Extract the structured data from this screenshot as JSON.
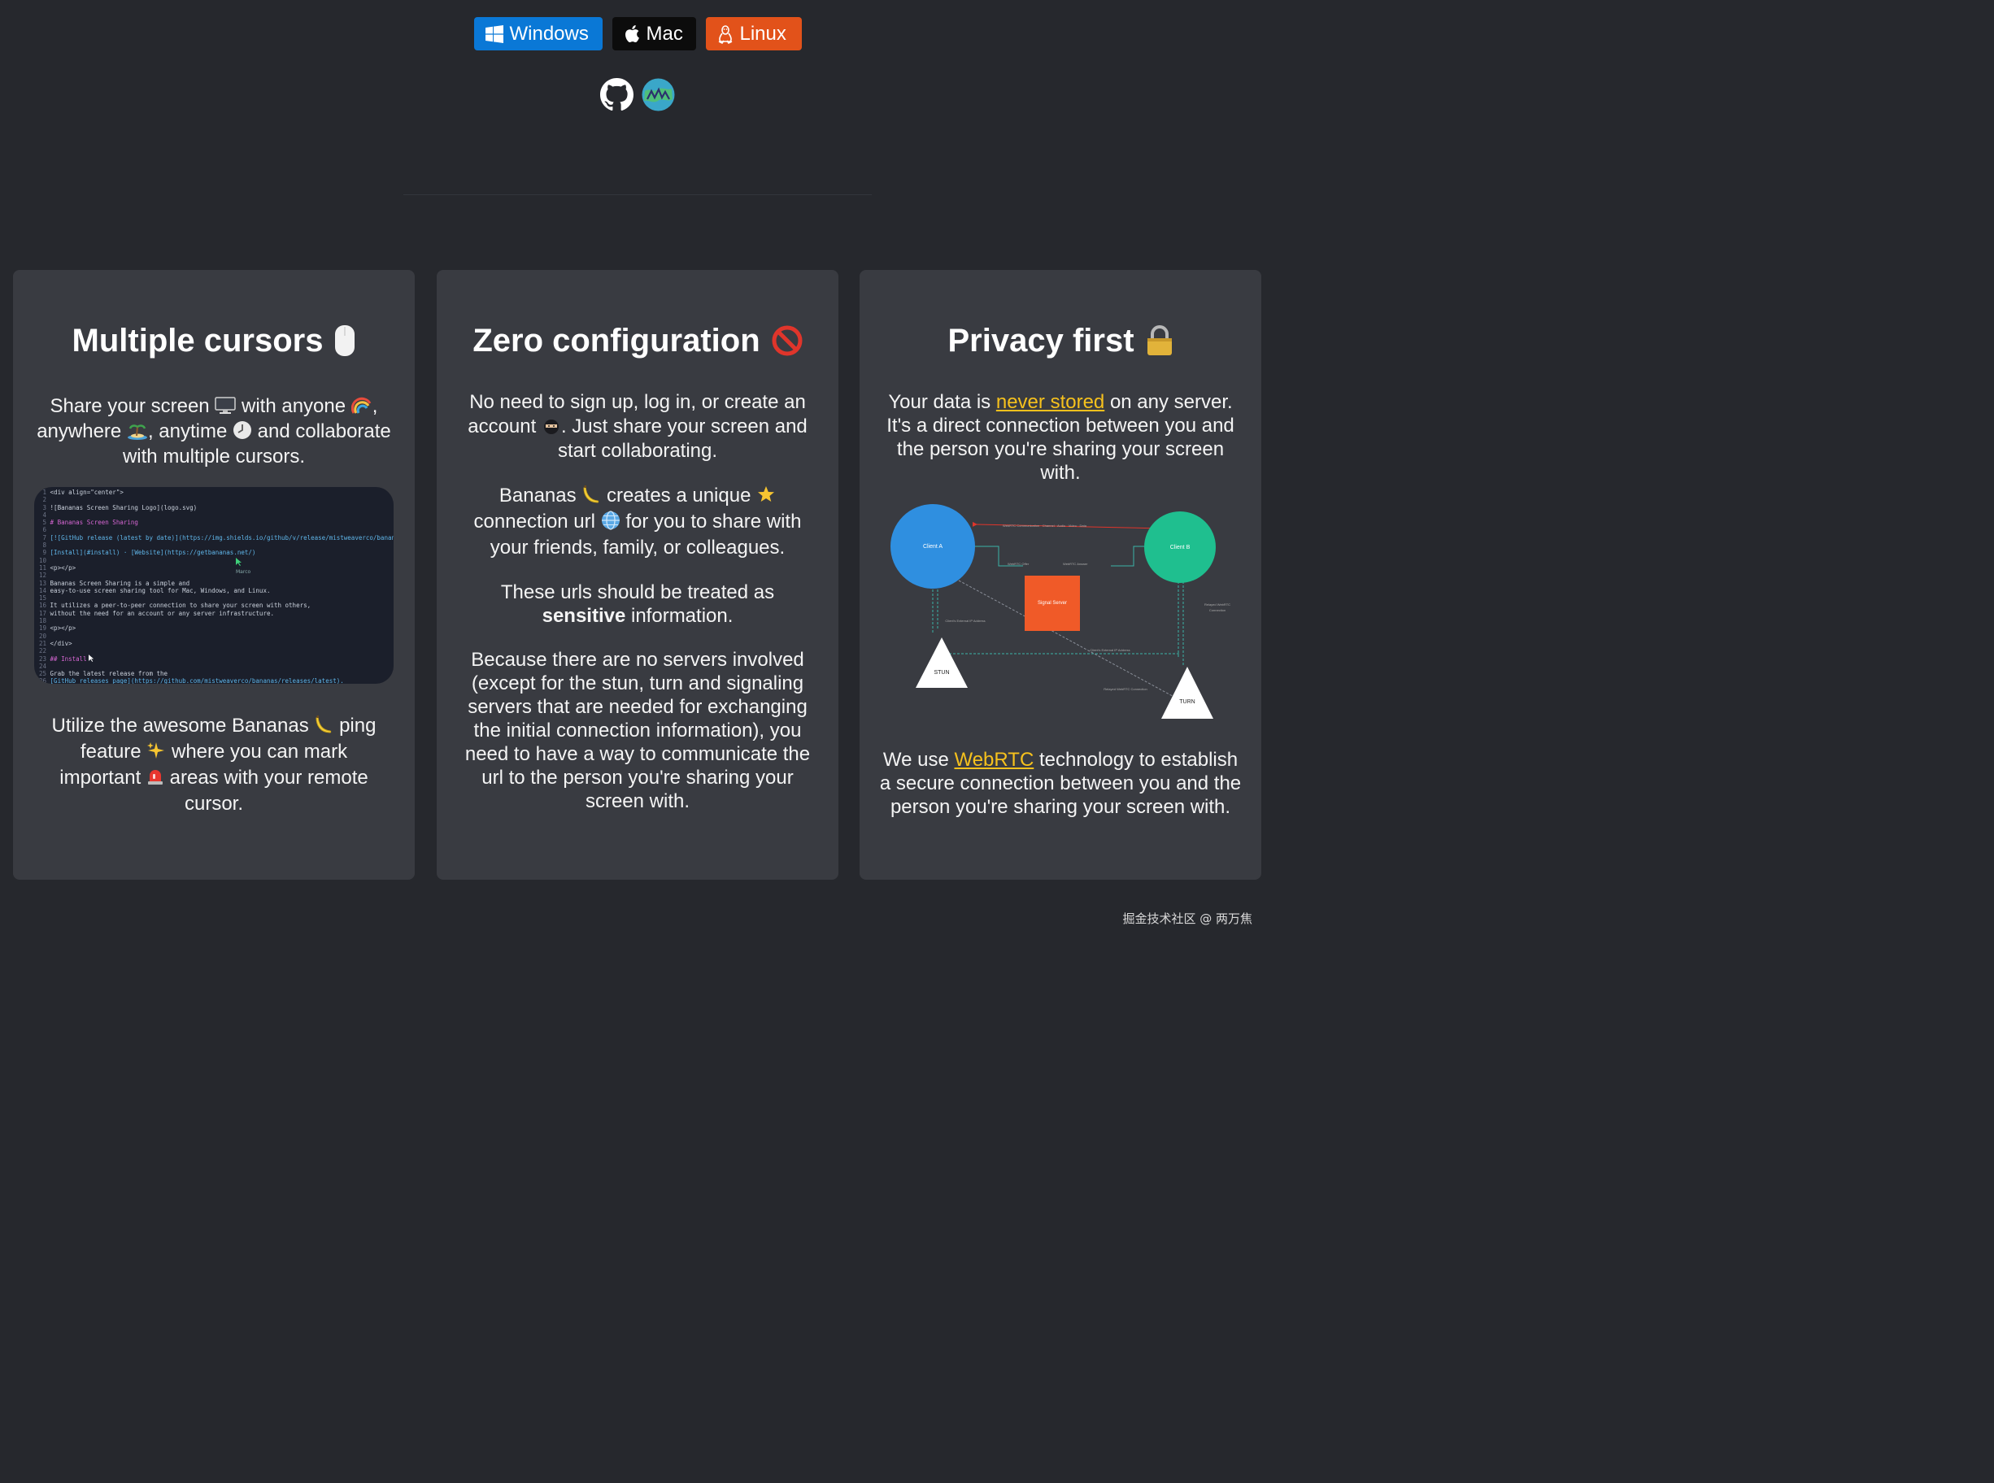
{
  "downloads": {
    "windows_label": "Windows",
    "mac_label": "Mac",
    "linux_label": "Linux"
  },
  "social": {
    "github": "github-icon",
    "website": "globe-logo-icon"
  },
  "colors": {
    "background": "#26282d",
    "card": "#393b41",
    "windows": "#0a78d6",
    "mac": "#0c0c0c",
    "linux": "#e2521a",
    "link": "#f6c11d"
  },
  "cards": [
    {
      "title": "Multiple cursors",
      "title_icon": "computer-mouse",
      "paragraphs": {
        "intro_1": "Share your screen",
        "intro_2": "with anyone",
        "intro_3": ",",
        "intro_4": "anywhere",
        "intro_5": ", anytime",
        "intro_6": "and collaborate",
        "intro_7": "with multiple cursors.",
        "ping_1": "Utilize the awesome Bananas",
        "ping_2": "ping",
        "ping_3": "feature",
        "ping_4": "where you can mark",
        "ping_5": "important",
        "ping_6": "areas with your remote",
        "ping_7": "cursor."
      },
      "code_lines": [
        {
          "n": "1",
          "t": "<div align=\"center\">"
        },
        {
          "n": "2",
          "t": ""
        },
        {
          "n": "3",
          "t": "![Bananas Screen Sharing Logo](logo.svg)"
        },
        {
          "n": "4",
          "t": ""
        },
        {
          "n": "5",
          "t": "# Bananas Screen Sharing"
        },
        {
          "n": "6",
          "t": ""
        },
        {
          "n": "7",
          "t": "[![GitHub release (latest by date)](https://img.shields.io/github/v/release/mistweaverco/bananas"
        },
        {
          "n": "8",
          "t": ""
        },
        {
          "n": "9",
          "t": "[Install](#install) · [Website](https://getbananas.net/)"
        },
        {
          "n": "10",
          "t": ""
        },
        {
          "n": "11",
          "t": "<p></p>"
        },
        {
          "n": "12",
          "t": ""
        },
        {
          "n": "13",
          "t": "Bananas Screen Sharing is a simple and"
        },
        {
          "n": "14",
          "t": "easy-to-use screen sharing tool for Mac, Windows, and Linux."
        },
        {
          "n": "15",
          "t": ""
        },
        {
          "n": "16",
          "t": "It utilizes a peer-to-peer connection to share your screen with others,"
        },
        {
          "n": "17",
          "t": "without the need for an account or any server infrastructure."
        },
        {
          "n": "18",
          "t": ""
        },
        {
          "n": "19",
          "t": "<p></p>"
        },
        {
          "n": "20",
          "t": ""
        },
        {
          "n": "21",
          "t": "</div>"
        },
        {
          "n": "22",
          "t": ""
        },
        {
          "n": "23",
          "t": "## Install"
        },
        {
          "n": "24",
          "t": ""
        },
        {
          "n": "25",
          "t": "Grab the latest release from the"
        },
        {
          "n": "26",
          "t": "[GitHub releases page](https://github.com/mistweaverco/bananas/releases/latest)."
        }
      ],
      "cursor_label": "Marco"
    },
    {
      "title": "Zero configuration",
      "title_icon": "prohibited",
      "paragraphs": {
        "p1_a": "No need to sign up, log in, or create an",
        "p1_b": "account",
        "p1_c": ". Just share your screen and",
        "p1_d": "start collaborating.",
        "p2_a": "Bananas",
        "p2_b": "creates a unique",
        "p2_c": "connection url",
        "p2_d": "for you to share with",
        "p2_e": "your friends, family, or colleagues.",
        "p3_a": "These urls should be treated as",
        "p3_b": "sensitive",
        "p3_c": "information.",
        "p4": "Because there are no servers involved (except for the stun, turn and signaling servers that are needed for exchanging the initial connection information), you need to have a way to communicate the url to the person you're sharing your screen with."
      }
    },
    {
      "title": "Privacy first",
      "title_icon": "lock",
      "paragraphs": {
        "p1_a": "Your data is",
        "p1_link": "never stored",
        "p1_b": "on any server. It's a direct connection between you and the person you're sharing your screen with.",
        "p2_a": "We use",
        "p2_link": "WebRTC",
        "p2_b": "technology to establish a secure connection between you and the person you're sharing your screen with."
      },
      "diagram": {
        "client_a": "Client A",
        "client_b": "Client B",
        "signal_server": "Signal Server",
        "stun": "STUN",
        "turn": "TURN",
        "webrtc_comm": "WebRTC Communication · Channel · Audio · Video · Data",
        "offer": "WebRTC Offer",
        "answer": "WebRTC Answer",
        "client_a_ip": "Client's External IP Address",
        "client_b_ip": "Client's External IP Address",
        "relayed_a": "Relayed WebRTC Connection",
        "relayed_b": "Relayed WebRTC Connection"
      }
    }
  ],
  "watermark": "掘金技术社区 @ 两万焦"
}
